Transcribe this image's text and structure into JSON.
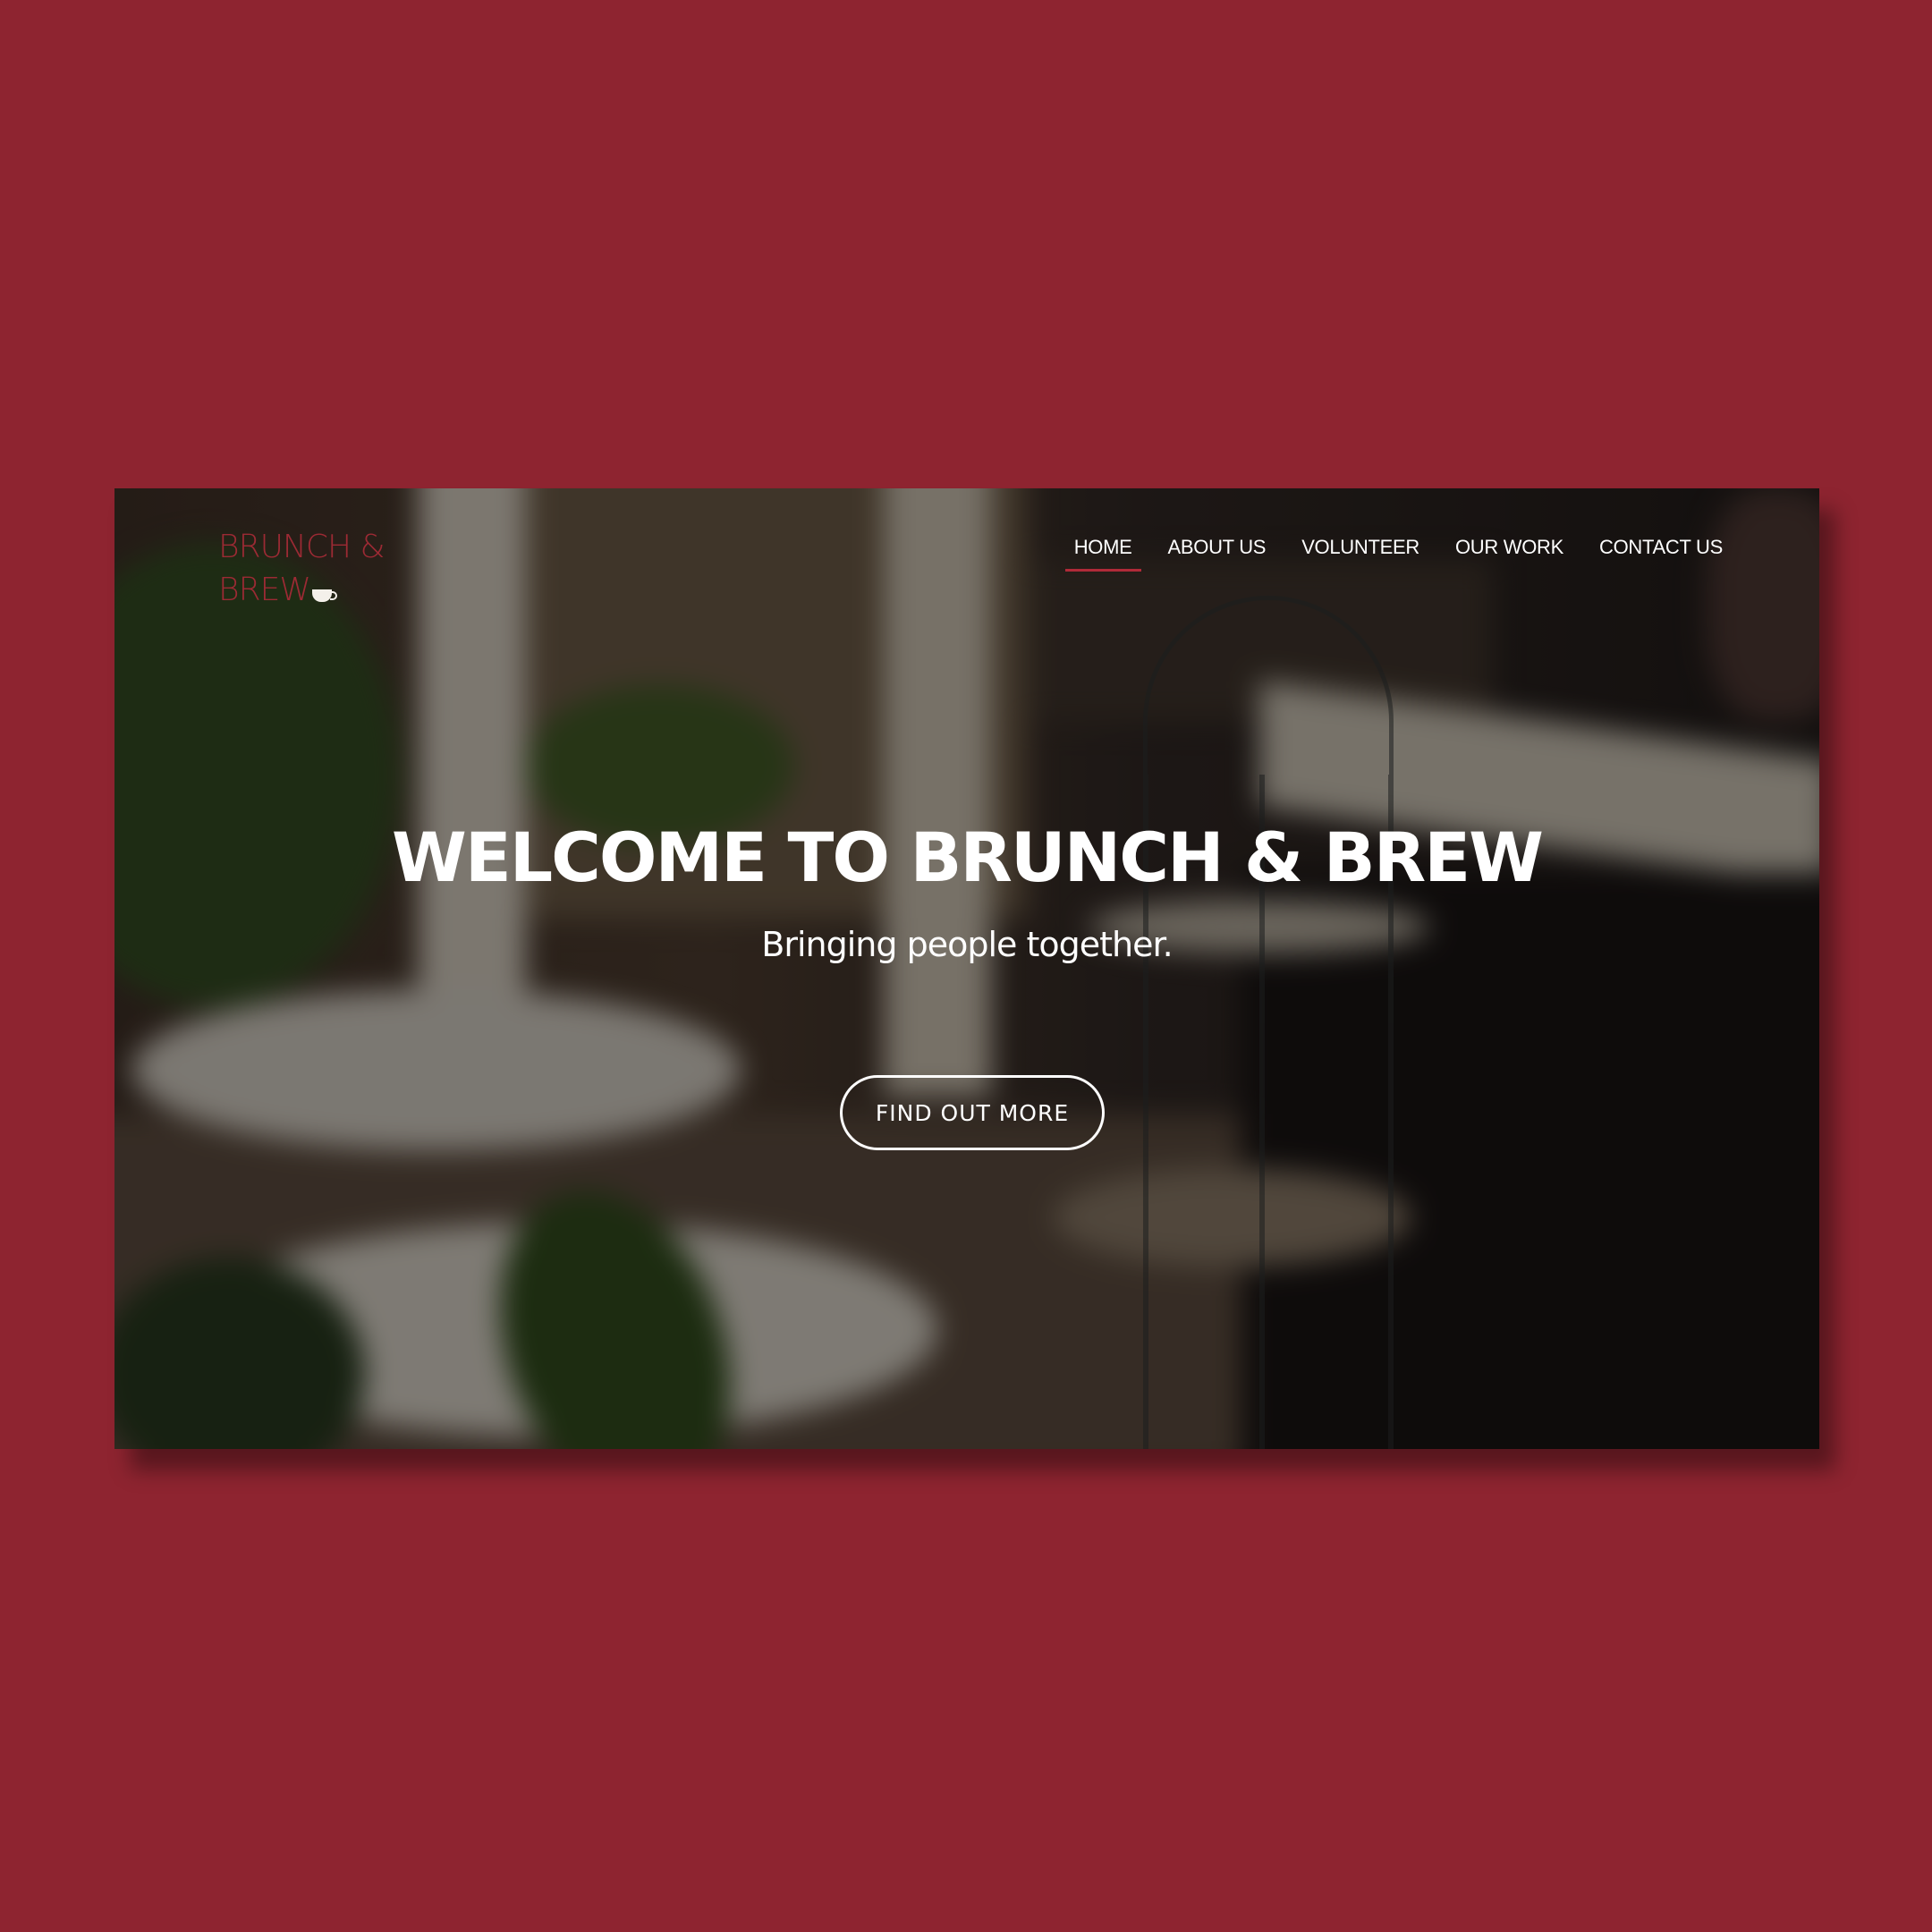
{
  "colors": {
    "page_background": "#8e2430",
    "brand_red": "#9c2a34",
    "nav_active_underline": "#b02a38",
    "text_light": "#ffffff"
  },
  "brand": {
    "line1": "BRUNCH &",
    "line2": "BREW",
    "icon": "coffee-cup-icon"
  },
  "nav": {
    "items": [
      {
        "label": "HOME",
        "active": true
      },
      {
        "label": "ABOUT US",
        "active": false
      },
      {
        "label": "VOLUNTEER",
        "active": false
      },
      {
        "label": "OUR WORK",
        "active": false
      },
      {
        "label": "CONTACT US",
        "active": false
      }
    ]
  },
  "hero": {
    "title": "WELCOME TO BRUNCH & BREW",
    "subtitle": "Bringing people together.",
    "cta_label": "FIND OUT MORE"
  }
}
